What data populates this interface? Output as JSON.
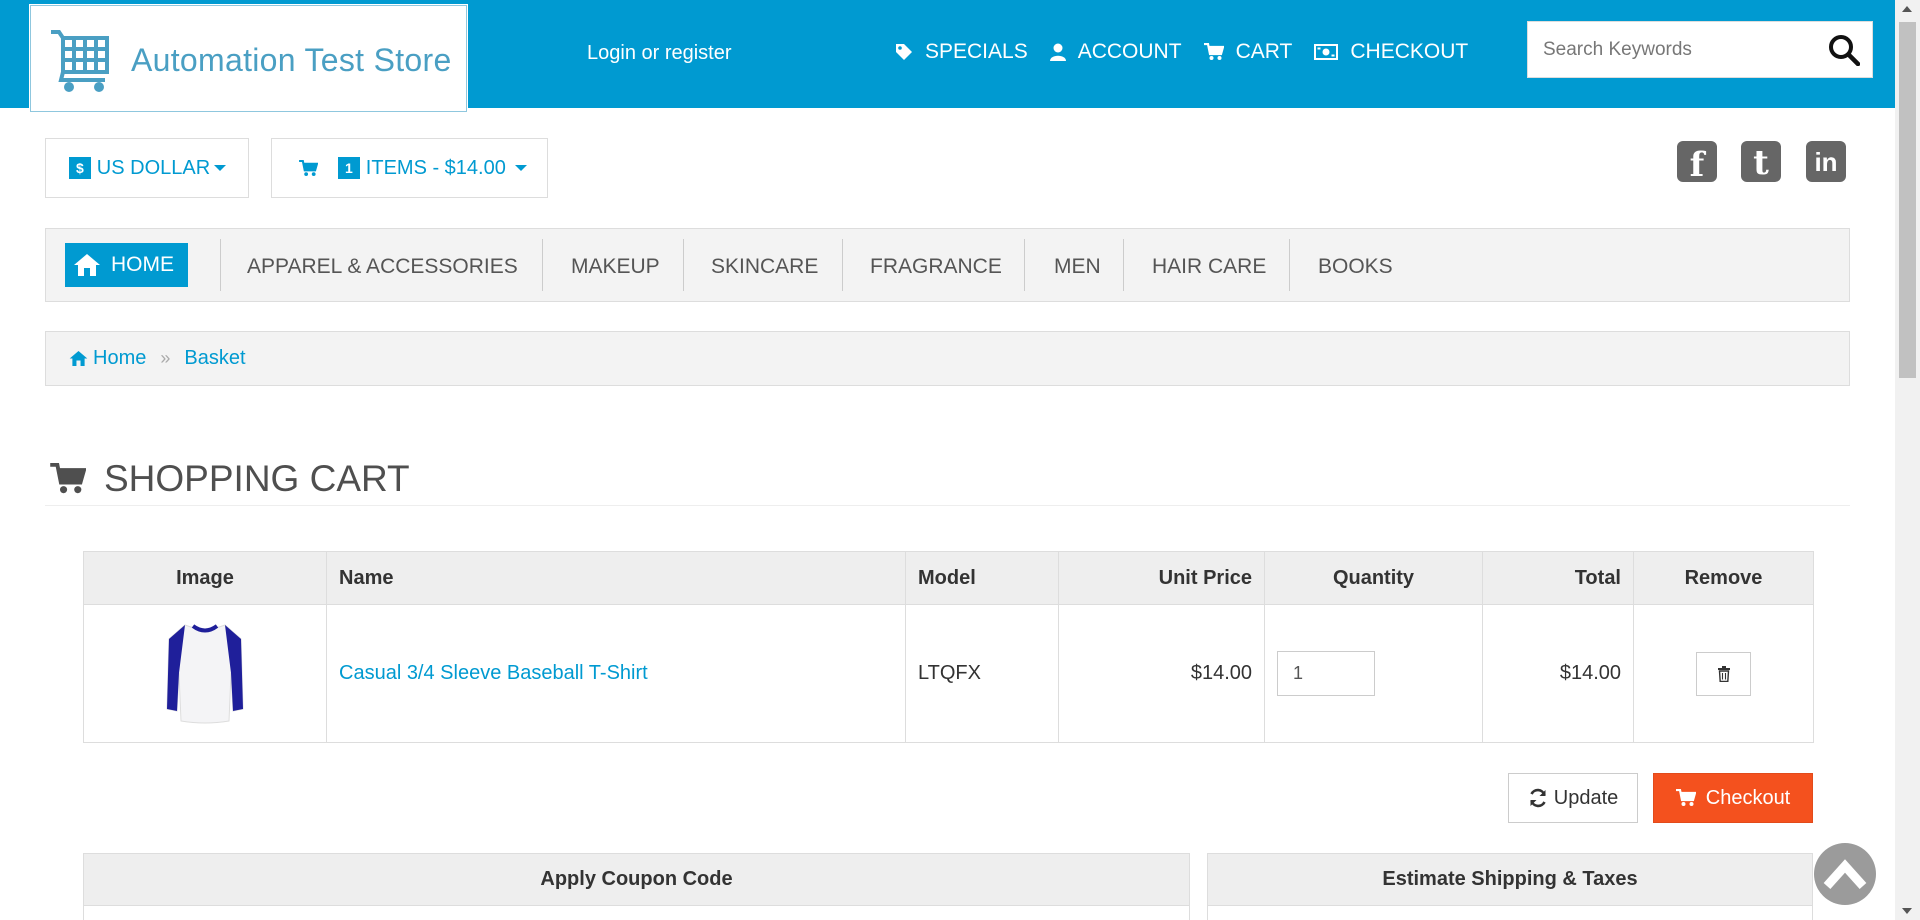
{
  "header": {
    "logo_text": "Automation Test Store",
    "login_link": "Login or register",
    "nav": [
      {
        "label": "SPECIALS",
        "icon": "tag-icon"
      },
      {
        "label": "ACCOUNT",
        "icon": "user-icon"
      },
      {
        "label": "CART",
        "icon": "cart-icon"
      },
      {
        "label": "CHECKOUT",
        "icon": "money-icon"
      }
    ],
    "search_placeholder": "Search Keywords",
    "accent_color": "#009ad1"
  },
  "toolbar": {
    "currency_symbol": "$",
    "currency_label": "US DOLLAR",
    "cart_count": "1",
    "cart_summary": "ITEMS - $14.00"
  },
  "social": [
    {
      "name": "facebook",
      "glyph": "f"
    },
    {
      "name": "twitter",
      "glyph": "t"
    },
    {
      "name": "linkedin",
      "glyph": "in"
    }
  ],
  "categories": {
    "home": "HOME",
    "items": [
      "APPAREL & ACCESSORIES",
      "MAKEUP",
      "SKINCARE",
      "FRAGRANCE",
      "MEN",
      "HAIR CARE",
      "BOOKS"
    ]
  },
  "breadcrumb": {
    "home": "Home",
    "current": "Basket"
  },
  "page": {
    "title": "SHOPPING CART"
  },
  "cart_table": {
    "headers": [
      "Image",
      "Name",
      "Model",
      "Unit Price",
      "Quantity",
      "Total",
      "Remove"
    ],
    "rows": [
      {
        "name": "Casual 3/4 Sleeve Baseball T-Shirt",
        "model": "LTQFX",
        "unit_price": "$14.00",
        "quantity": "1",
        "total": "$14.00"
      }
    ]
  },
  "actions": {
    "update": "Update",
    "checkout": "Checkout",
    "checkout_color": "#f4511e"
  },
  "panels": {
    "coupon": "Apply Coupon Code",
    "shipping": "Estimate Shipping & Taxes"
  }
}
